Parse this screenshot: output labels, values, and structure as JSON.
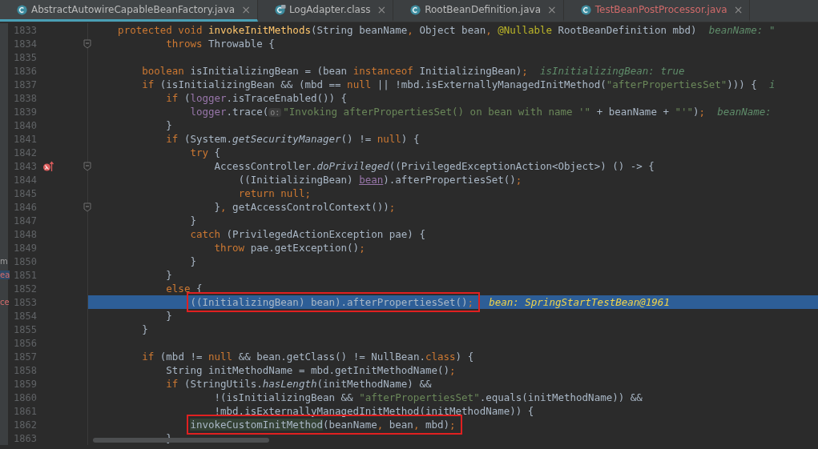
{
  "tabs": [
    {
      "label": "AbstractAutowireCapableBeanFactory.java",
      "kind": "class",
      "selected": true,
      "error": false,
      "close": "×"
    },
    {
      "label": "LogAdapter.class",
      "kind": "compiled",
      "selected": false,
      "error": false,
      "close": "×"
    },
    {
      "label": "RootBeanDefinition.java",
      "kind": "class",
      "selected": false,
      "error": false,
      "close": "×"
    },
    {
      "label": "TestBeanPostProcessor.java",
      "kind": "class",
      "selected": false,
      "error": true,
      "close": "×"
    }
  ],
  "lines": [
    {
      "n": "1833",
      "code": [
        {
          "kind": "keyword",
          "t": "    protected void "
        },
        {
          "kind": "decl",
          "t": "invokeInitMethods"
        },
        {
          "kind": "plain",
          "t": "(String beanName"
        },
        {
          "kind": "keyword",
          "t": ", "
        },
        {
          "kind": "plain",
          "t": "Object bean"
        },
        {
          "kind": "keyword",
          "t": ", "
        },
        {
          "kind": "annotation",
          "t": "@Nullable"
        },
        {
          "kind": "plain",
          "t": " RootBeanDefinition mbd)"
        }
      ],
      "hint": "beanName: \""
    },
    {
      "n": "1834",
      "fold": true,
      "code": [
        {
          "kind": "keyword",
          "t": "            throws"
        },
        {
          "kind": "plain",
          "t": " Throwable {"
        }
      ]
    },
    {
      "n": "1835"
    },
    {
      "n": "1836",
      "code": [
        {
          "kind": "keyword",
          "t": "        boolean"
        },
        {
          "kind": "plain",
          "t": " isInitializingBean = (bean "
        },
        {
          "kind": "keyword",
          "t": "instanceof"
        },
        {
          "kind": "plain",
          "t": " InitializingBean)"
        },
        {
          "kind": "keyword",
          "t": ";"
        }
      ],
      "hint": "isInitializingBean: true"
    },
    {
      "n": "1837",
      "code": [
        {
          "kind": "keyword",
          "t": "        if"
        },
        {
          "kind": "plain",
          "t": " (isInitializingBean && (mbd == "
        },
        {
          "kind": "keyword",
          "t": "null"
        },
        {
          "kind": "plain",
          "t": " || !mbd.isExternallyManagedInitMethod("
        },
        {
          "kind": "string",
          "t": "\"afterPropertiesSet\""
        },
        {
          "kind": "plain",
          "t": "))) {"
        }
      ],
      "hint": "i"
    },
    {
      "n": "1838",
      "code": [
        {
          "kind": "keyword",
          "t": "            if"
        },
        {
          "kind": "plain",
          "t": " ("
        },
        {
          "kind": "field",
          "t": "logger"
        },
        {
          "kind": "plain",
          "t": ".isTraceEnabled()) {"
        }
      ]
    },
    {
      "n": "1839",
      "code": [
        {
          "kind": "field",
          "t": "                logger"
        },
        {
          "kind": "plain",
          "t": ".trace("
        },
        {
          "kind": "param",
          "t": "o:"
        },
        {
          "kind": "string",
          "t": "\"Invoking afterPropertiesSet() on bean with name '\""
        },
        {
          "kind": "plain",
          "t": " + beanName + "
        },
        {
          "kind": "string",
          "t": "\"'\""
        },
        {
          "kind": "plain",
          "t": ")"
        },
        {
          "kind": "keyword",
          "t": ";"
        }
      ],
      "hint": "beanName:"
    },
    {
      "n": "1840",
      "code": [
        {
          "kind": "plain",
          "t": "            }"
        }
      ]
    },
    {
      "n": "1841",
      "code": [
        {
          "kind": "keyword",
          "t": "            if"
        },
        {
          "kind": "plain",
          "t": " (System."
        },
        {
          "kind": "static",
          "t": "getSecurityManager"
        },
        {
          "kind": "plain",
          "t": "() != "
        },
        {
          "kind": "keyword",
          "t": "null"
        },
        {
          "kind": "plain",
          "t": ") {"
        }
      ]
    },
    {
      "n": "1842",
      "code": [
        {
          "kind": "keyword",
          "t": "                try"
        },
        {
          "kind": "plain",
          "t": " {"
        }
      ]
    },
    {
      "n": "1843",
      "breakpoint": true,
      "fold": true,
      "code": [
        {
          "kind": "plain",
          "t": "                    AccessController."
        },
        {
          "kind": "static",
          "t": "doPrivileged"
        },
        {
          "kind": "plain",
          "t": "((PrivilegedExceptionAction<Object>) () -> {"
        }
      ]
    },
    {
      "n": "1844",
      "code": [
        {
          "kind": "plain",
          "t": "                        ((InitializingBean) "
        },
        {
          "kind": "captured",
          "t": "bean"
        },
        {
          "kind": "plain",
          "t": ").afterPropertiesSet()"
        },
        {
          "kind": "keyword",
          "t": ";"
        }
      ]
    },
    {
      "n": "1845",
      "code": [
        {
          "kind": "keyword",
          "t": "                        return null;"
        }
      ]
    },
    {
      "n": "1846",
      "fold": true,
      "code": [
        {
          "kind": "plain",
          "t": "                    }"
        },
        {
          "kind": "keyword",
          "t": ", "
        },
        {
          "kind": "plain",
          "t": "getAccessControlContext())"
        },
        {
          "kind": "keyword",
          "t": ";"
        }
      ]
    },
    {
      "n": "1847",
      "code": [
        {
          "kind": "plain",
          "t": "                }"
        }
      ]
    },
    {
      "n": "1848",
      "code": [
        {
          "kind": "keyword",
          "t": "                catch"
        },
        {
          "kind": "plain",
          "t": " (PrivilegedActionException pae) {"
        }
      ]
    },
    {
      "n": "1849",
      "code": [
        {
          "kind": "keyword",
          "t": "                    throw"
        },
        {
          "kind": "plain",
          "t": " pae.getException()"
        },
        {
          "kind": "keyword",
          "t": ";"
        }
      ]
    },
    {
      "n": "1850",
      "side": {
        "text": "m",
        "error": false,
        "selected": false
      },
      "code": [
        {
          "kind": "plain",
          "t": "                }"
        }
      ]
    },
    {
      "n": "1851",
      "side": {
        "text": "ea",
        "error": true,
        "selected": true
      },
      "code": [
        {
          "kind": "plain",
          "t": "            }"
        }
      ]
    },
    {
      "n": "1852",
      "code": [
        {
          "kind": "keyword",
          "t": "            else"
        },
        {
          "kind": "plain",
          "t": " {"
        }
      ]
    },
    {
      "n": "1853",
      "current": true,
      "boxed": true,
      "side": {
        "text": "ce",
        "error": true,
        "selected": false
      },
      "code": [
        {
          "kind": "plain",
          "t": "                ((InitializingBean) bean).afterPropertiesSet()"
        },
        {
          "kind": "keyword",
          "t": ";"
        }
      ],
      "hint": "bean: SpringStartTestBean@1961"
    },
    {
      "n": "1854",
      "code": [
        {
          "kind": "plain",
          "t": "            }"
        }
      ]
    },
    {
      "n": "1855",
      "code": [
        {
          "kind": "plain",
          "t": "        }"
        }
      ]
    },
    {
      "n": "1856"
    },
    {
      "n": "1857",
      "code": [
        {
          "kind": "keyword",
          "t": "        if"
        },
        {
          "kind": "plain",
          "t": " (mbd != "
        },
        {
          "kind": "keyword",
          "t": "null"
        },
        {
          "kind": "plain",
          "t": " && bean.getClass() != NullBean."
        },
        {
          "kind": "keyword",
          "t": "class"
        },
        {
          "kind": "plain",
          "t": ") {"
        }
      ]
    },
    {
      "n": "1858",
      "code": [
        {
          "kind": "plain",
          "t": "            String initMethodName = mbd.getInitMethodName()"
        },
        {
          "kind": "keyword",
          "t": ";"
        }
      ]
    },
    {
      "n": "1859",
      "code": [
        {
          "kind": "keyword",
          "t": "            if"
        },
        {
          "kind": "plain",
          "t": " (StringUtils."
        },
        {
          "kind": "static",
          "t": "hasLength"
        },
        {
          "kind": "plain",
          "t": "(initMethodName) &&"
        }
      ]
    },
    {
      "n": "1860",
      "code": [
        {
          "kind": "plain",
          "t": "                    !(isInitializingBean && "
        },
        {
          "kind": "string",
          "t": "\"afterPropertiesSet\""
        },
        {
          "kind": "plain",
          "t": ".equals(initMethodName)) &&"
        }
      ]
    },
    {
      "n": "1861",
      "code": [
        {
          "kind": "plain",
          "t": "                    !mbd.isExternallyManagedInitMethod(initMethodName)) {"
        }
      ]
    },
    {
      "n": "1862",
      "boxed": true,
      "code": [
        {
          "kind": "match",
          "t": "                invokeCustomInitMethod"
        },
        {
          "kind": "plain",
          "t": "(beanName"
        },
        {
          "kind": "keyword",
          "t": ", "
        },
        {
          "kind": "plain",
          "t": "bean"
        },
        {
          "kind": "keyword",
          "t": ", "
        },
        {
          "kind": "plain",
          "t": "mbd)"
        },
        {
          "kind": "keyword",
          "t": ";"
        }
      ]
    },
    {
      "n": "1863",
      "code": [
        {
          "kind": "plain",
          "t": "            }"
        }
      ]
    }
  ]
}
